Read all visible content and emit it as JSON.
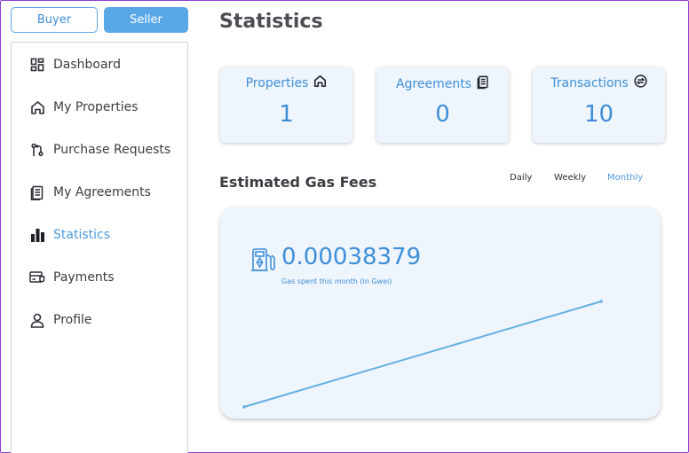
{
  "role_toggle": {
    "buyer_label": "Buyer",
    "seller_label": "Seller",
    "selected": "Seller"
  },
  "sidebar": {
    "items": [
      {
        "label": "Dashboard",
        "icon": "dashboard-icon"
      },
      {
        "label": "My Properties",
        "icon": "home-icon"
      },
      {
        "label": "Purchase Requests",
        "icon": "git-pull-request-icon"
      },
      {
        "label": "My Agreements",
        "icon": "document-icon"
      },
      {
        "label": "Statistics",
        "icon": "bar-chart-icon",
        "active": true
      },
      {
        "label": "Payments",
        "icon": "payment-card-icon"
      },
      {
        "label": "Profile",
        "icon": "user-icon"
      }
    ]
  },
  "main": {
    "title": "Statistics",
    "cards": [
      {
        "label": "Properties",
        "value": "1",
        "icon": "home-icon"
      },
      {
        "label": "Agreements",
        "value": "0",
        "icon": "document-icon"
      },
      {
        "label": "Transactions",
        "value": "10",
        "icon": "exchange-icon"
      }
    ],
    "gas_section": {
      "title": "Estimated Gas Fees",
      "periods": [
        "Daily",
        "Weekly",
        "Monthly"
      ],
      "active_period": "Monthly",
      "value": "0.00038379",
      "caption": "Gas spent this month (in Gwei)",
      "icon": "gas-pump-icon"
    }
  },
  "colors": {
    "accent": "#4b9ae0",
    "card_bg": "#eef5fc",
    "line": "#64b0e4"
  },
  "chart_data": {
    "type": "line",
    "title": "",
    "xlabel": "",
    "ylabel": "",
    "series": [
      {
        "values": [
          0,
          1
        ]
      }
    ],
    "grid": false
  }
}
